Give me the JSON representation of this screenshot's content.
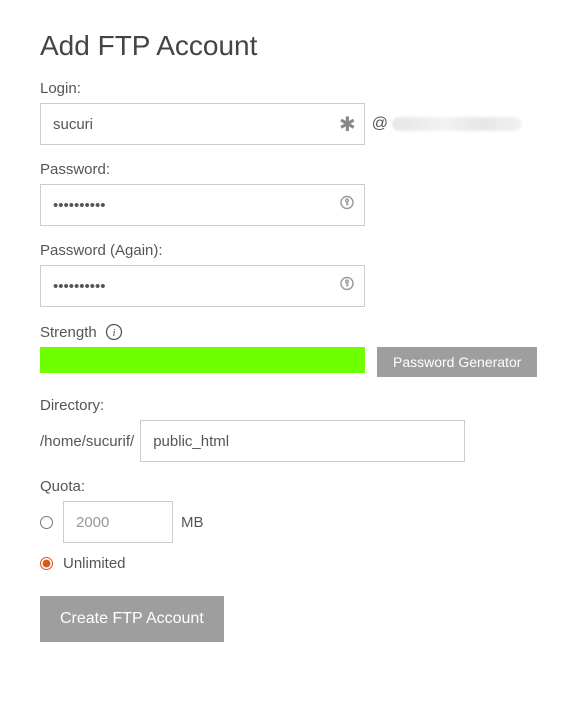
{
  "title": "Add FTP Account",
  "login": {
    "label": "Login:",
    "value": "sucuri",
    "at": "@"
  },
  "password1": {
    "label": "Password:",
    "value": "••••••••••"
  },
  "password2": {
    "label": "Password (Again):",
    "value": "••••••••••"
  },
  "strength": {
    "label": "Strength",
    "color": "#6eff00",
    "generator_button": "Password Generator"
  },
  "directory": {
    "label": "Directory:",
    "prefix": "/home/sucurif/",
    "value": "public_html"
  },
  "quota": {
    "label": "Quota:",
    "value": "2000",
    "unit": "MB",
    "unlimited_label": "Unlimited",
    "selected": "unlimited"
  },
  "submit_label": "Create FTP Account"
}
